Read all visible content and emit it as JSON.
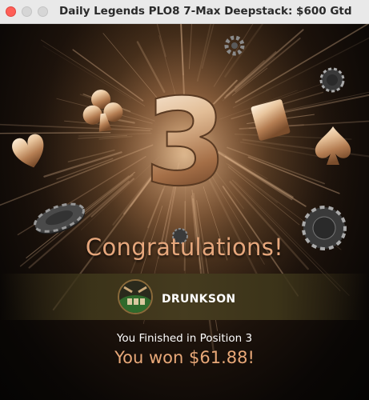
{
  "window": {
    "title": "Daily Legends PLO8 7-Max Deepstack: $600 Gtd",
    "controls": [
      "close-button",
      "minimize-button",
      "zoom-button"
    ]
  },
  "hero": {
    "number": "3",
    "decorations": [
      "club-icon",
      "heart-icon",
      "diamond-icon",
      "spade-icon",
      "poker-chip-icon",
      "gear-icon"
    ]
  },
  "result": {
    "congrats": "Congratulations!",
    "player_name": "DRUNKSON",
    "position_text": "You Finished in Position 3",
    "won_text": "You won $61.88!"
  },
  "colors": {
    "accent": "#e6a77c",
    "titlebar": "#e9e9e9",
    "close": "#fe5f57"
  }
}
